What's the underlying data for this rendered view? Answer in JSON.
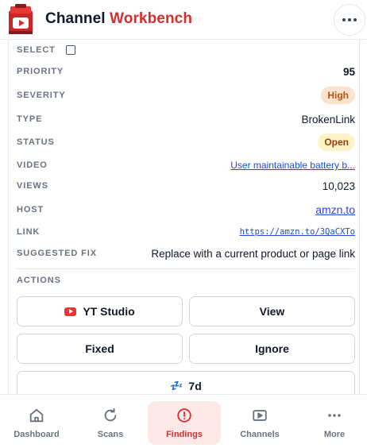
{
  "header": {
    "brand_part1": "Channel",
    "brand_part2": "Workbench"
  },
  "details": {
    "select_label": "SELECT",
    "priority_label": "PRIORITY",
    "priority_value": "95",
    "severity_label": "SEVERITY",
    "severity_value": "High",
    "type_label": "TYPE",
    "type_value": "BrokenLink",
    "status_label": "STATUS",
    "status_value": "Open",
    "video_label": "VIDEO",
    "video_value": "User maintainable battery b...",
    "views_label": "VIEWS",
    "views_value": "10,023",
    "host_label": "HOST",
    "host_value": "amzn.to",
    "link_label": "LINK",
    "link_value": "https://amzn.to/3QaCXTo",
    "fix_label": "SUGGESTED FIX",
    "fix_value": "Replace with a current product or page link"
  },
  "actions": {
    "label": "ACTIONS",
    "yt_studio": "YT Studio",
    "view": "View",
    "fixed": "Fixed",
    "ignore": "Ignore",
    "snooze": "7d"
  },
  "nav": {
    "dashboard": "Dashboard",
    "scans": "Scans",
    "findings": "Findings",
    "channels": "Channels",
    "more": "More"
  },
  "colors": {
    "accent": "#d32f2f",
    "high_badge_bg": "#fde3cf",
    "open_badge_bg": "#fef3c7",
    "link": "#1d4ed8"
  }
}
